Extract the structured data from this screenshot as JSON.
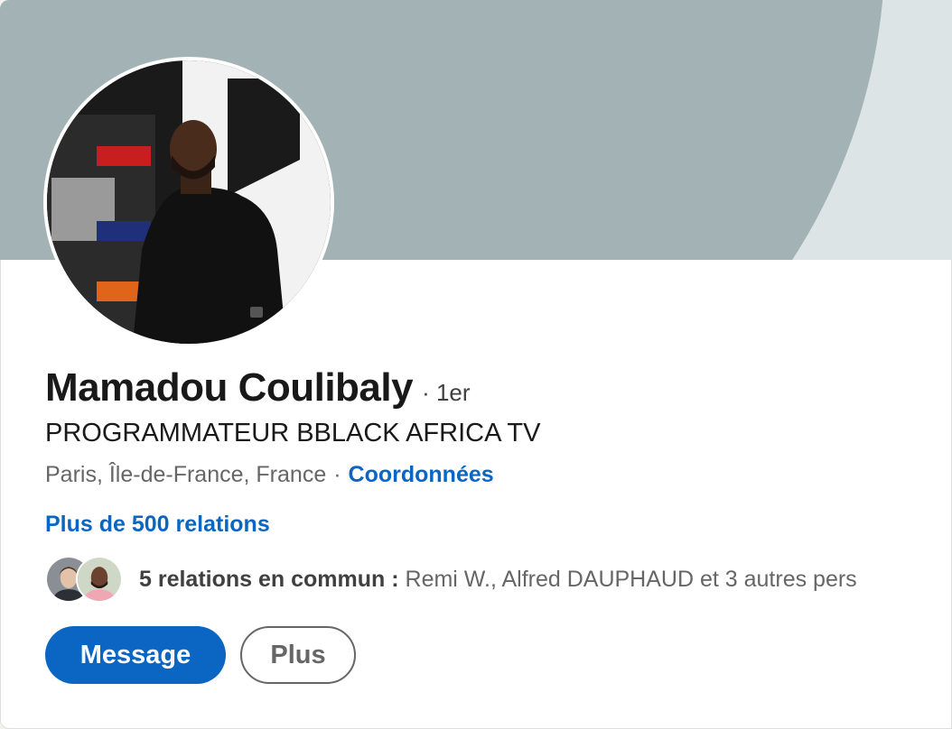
{
  "profile": {
    "name": "Mamadou Coulibaly",
    "degree": "· 1er",
    "headline": "PROGRAMMATEUR BBLACK AFRICA TV",
    "location": "Paris, Île-de-France, France",
    "separator": "·",
    "contact_link": "Coordonnées",
    "relations_link": "Plus de 500 relations"
  },
  "mutual": {
    "count_label": "5 relations en commun :",
    "names": "Remi W., Alfred DAUPHAUD et 3 autres pers"
  },
  "actions": {
    "message_label": "Message",
    "more_label": "Plus"
  },
  "colors": {
    "accent": "#0a66c2",
    "banner_light": "#dde4e6",
    "banner_dark": "#a3b2b5"
  },
  "icons": {
    "avatar": "profile-photo",
    "mutual_faces": [
      "mutual-avatar-1",
      "mutual-avatar-2"
    ]
  }
}
